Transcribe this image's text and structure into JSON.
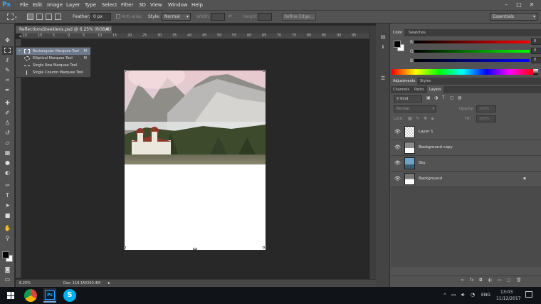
{
  "app": {
    "logo": "Ps"
  },
  "menubar": {
    "items": [
      "File",
      "Edit",
      "Image",
      "Layer",
      "Type",
      "Select",
      "Filter",
      "3D",
      "View",
      "Window",
      "Help"
    ],
    "window_controls": {
      "minimize": "–",
      "maximize": "□",
      "close": "✕"
    }
  },
  "options_bar": {
    "feather_label": "Feather:",
    "feather_value": "0 px",
    "antialias_label": "Anti-alias",
    "style_label": "Style:",
    "style_value": "Normal",
    "width_label": "Width:",
    "height_label": "Height:",
    "refine_edge": "Refine Edge...",
    "workspace": "Essentials"
  },
  "document": {
    "tab_title": "ReflectionsSteeklens.psd @ 6.25% (RGB/8) *",
    "ruler_marks": [
      "15",
      "10",
      "5",
      "0",
      "5",
      "10",
      "15",
      "20",
      "25",
      "30",
      "35",
      "40",
      "45",
      "50",
      "55",
      "60",
      "65",
      "70",
      "75",
      "80",
      "85",
      "90",
      "95"
    ]
  },
  "flyout": {
    "items": [
      {
        "label": "Rectangular Marquee Tool",
        "shortcut": "M",
        "selected": true
      },
      {
        "label": "Elliptical Marquee Tool",
        "shortcut": "M",
        "selected": false
      },
      {
        "label": "Single Row Marquee Tool",
        "shortcut": "",
        "selected": false
      },
      {
        "label": "Single Column Marquee Tool",
        "shortcut": "",
        "selected": false
      }
    ]
  },
  "status": {
    "zoom": "6.25%",
    "doc": "Doc: 118.1M/263.4M"
  },
  "color_panel": {
    "tabs": [
      "Color",
      "Swatches"
    ],
    "channels": [
      {
        "label": "R",
        "value": "0"
      },
      {
        "label": "G",
        "value": "0"
      },
      {
        "label": "B",
        "value": "0"
      }
    ]
  },
  "adjustments_panel": {
    "tabs": [
      "Adjustments",
      "Styles"
    ]
  },
  "layers_panel": {
    "tabs": [
      "Channels",
      "Paths",
      "Layers"
    ],
    "kind_label": "Kind",
    "blend_mode": "Normal",
    "opacity_label": "Opacity:",
    "opacity_value": "100%",
    "lock_label": "Lock:",
    "fill_label": "Fill:",
    "fill_value": "100%",
    "layers": [
      {
        "name": "Layer 1"
      },
      {
        "name": "Background copy"
      },
      {
        "name": "Sky"
      },
      {
        "name": "Background"
      }
    ]
  },
  "taskbar": {
    "language": "ENG",
    "time": "13:03",
    "date": "11/12/2017"
  }
}
